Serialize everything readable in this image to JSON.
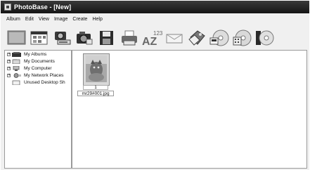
{
  "window": {
    "title": "PhotoBase - [New]"
  },
  "menu": [
    "Album",
    "Edit",
    "View",
    "Image",
    "Create",
    "Help"
  ],
  "toolbar": [
    {
      "icon": "gray-album-icon"
    },
    {
      "icon": "browser-window-icon"
    },
    {
      "icon": "scanner-camera-icon"
    },
    {
      "icon": "camera-icon"
    },
    {
      "icon": "floppy-disk-icon"
    },
    {
      "icon": "printer-icon"
    },
    {
      "icon": "sort-az-icon"
    },
    {
      "icon": "envelope-icon"
    },
    {
      "icon": "gift-tag-icon"
    },
    {
      "icon": "cd-export-icon"
    },
    {
      "icon": "cd-calculator-icon"
    },
    {
      "icon": "cd-case-icon"
    }
  ],
  "sort_icon_text": {
    "digits": "123",
    "letters": "AZ"
  },
  "tree": [
    {
      "label": "My Albums",
      "expander": "+",
      "icon": "albums-icon"
    },
    {
      "label": "My Documents",
      "expander": "+",
      "icon": "documents-folder-icon"
    },
    {
      "label": "My Computer",
      "expander": "+",
      "icon": "computer-icon"
    },
    {
      "label": "My Network Places",
      "expander": "+",
      "icon": "network-icon"
    },
    {
      "label": "Unused Desktop Sh",
      "expander": "",
      "icon": "folder-icon"
    }
  ],
  "files": [
    {
      "number": "1",
      "name": "mr29#001.jpg"
    }
  ]
}
